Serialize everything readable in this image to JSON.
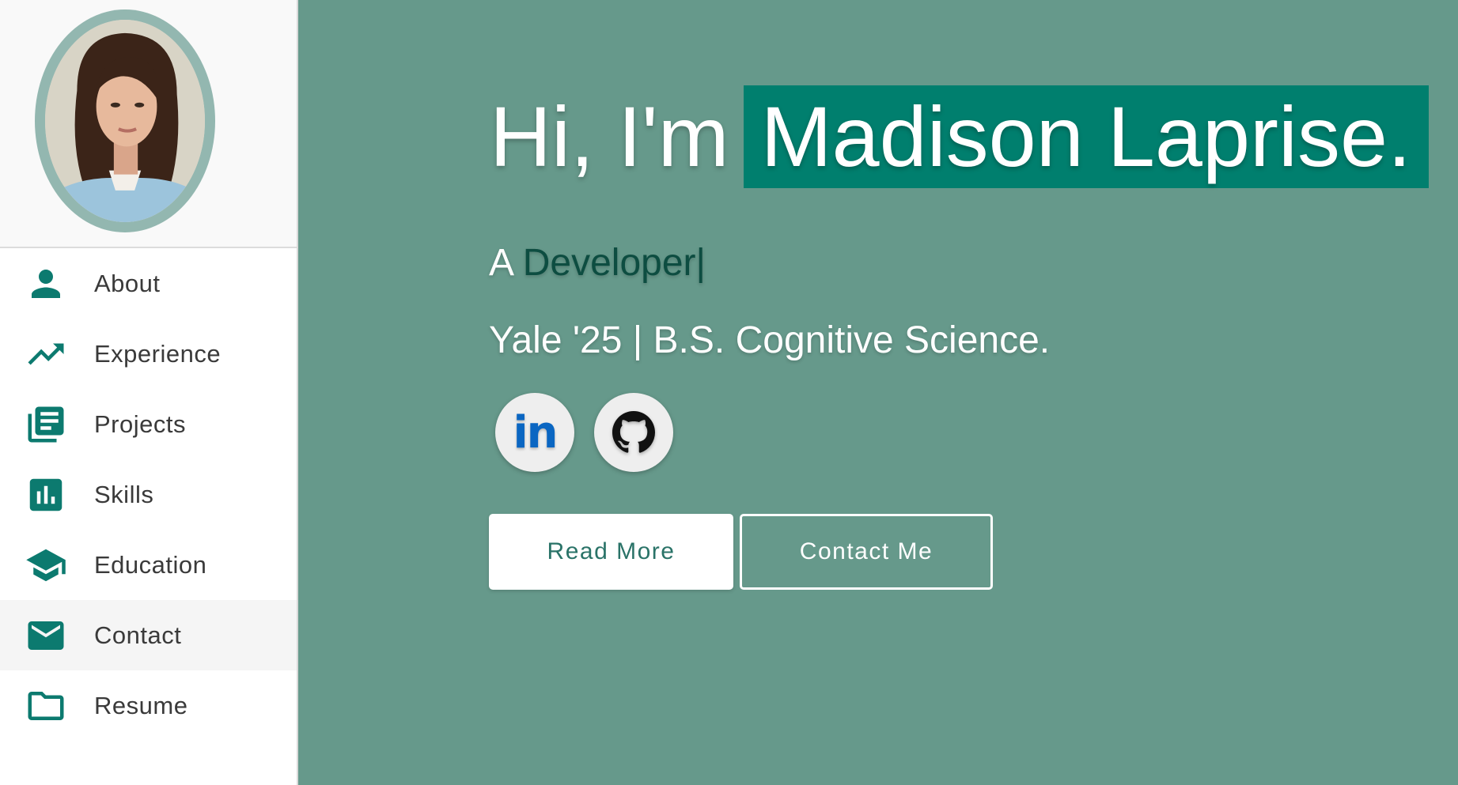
{
  "sidebar": {
    "items": [
      {
        "label": "About",
        "icon": "person-icon"
      },
      {
        "label": "Experience",
        "icon": "trending-up-icon"
      },
      {
        "label": "Projects",
        "icon": "library-books-icon"
      },
      {
        "label": "Skills",
        "icon": "bar-chart-icon"
      },
      {
        "label": "Education",
        "icon": "graduation-cap-icon"
      },
      {
        "label": "Contact",
        "icon": "envelope-icon"
      },
      {
        "label": "Resume",
        "icon": "folder-icon"
      }
    ]
  },
  "hero": {
    "greeting": "Hi, I'm",
    "name": "Madison Laprise.",
    "tagline_prefix": "A",
    "tagline_role": "Developer|",
    "subtitle": "Yale '25 | B.S. Cognitive Science."
  },
  "social": {
    "linkedin_glyph": "in"
  },
  "buttons": {
    "read_more": "Read More",
    "contact_me": "Contact Me"
  },
  "colors": {
    "background": "#66998b",
    "accent": "#007f6e",
    "icon": "#0c7a6f",
    "linkedin": "#0a66c2"
  }
}
